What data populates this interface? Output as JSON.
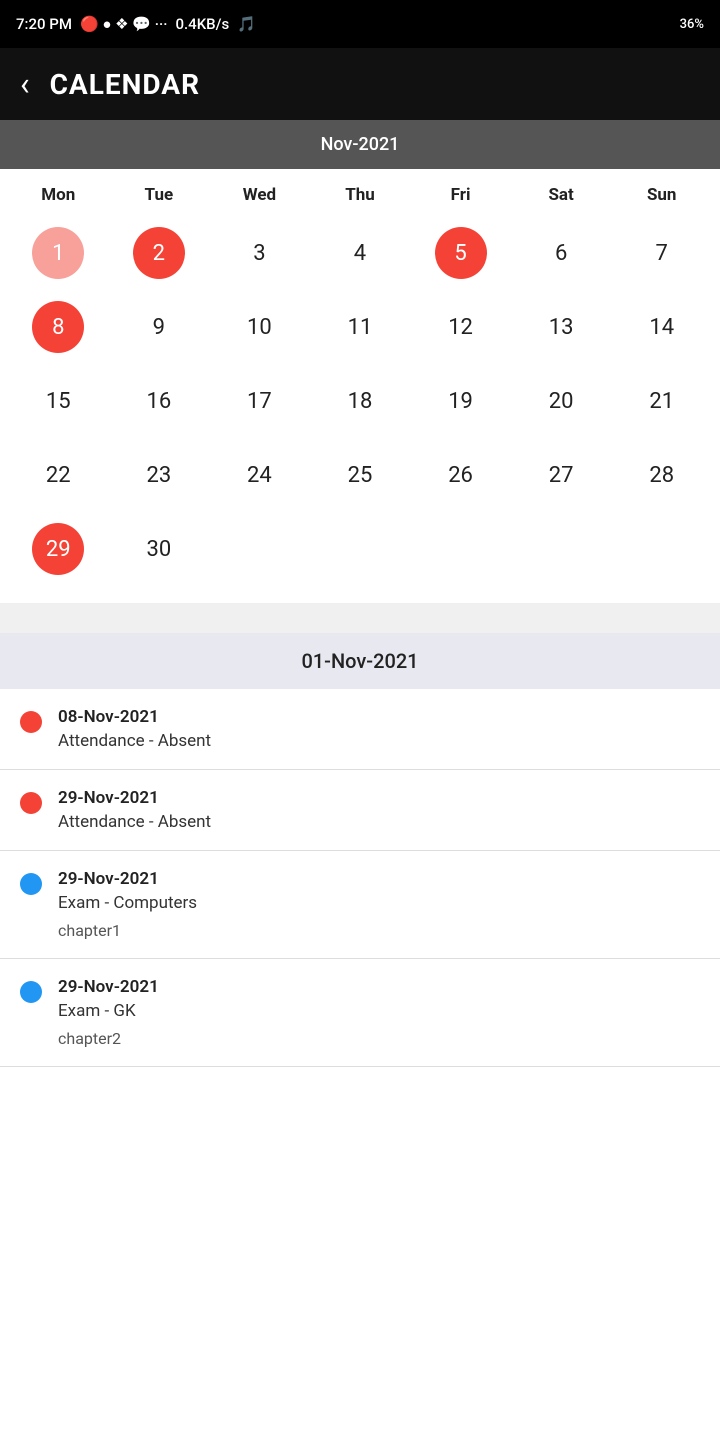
{
  "statusBar": {
    "time": "7:20 PM",
    "network": "0.4KB/s",
    "battery": "36%"
  },
  "header": {
    "back_label": "‹",
    "title": "CALENDAR"
  },
  "calendar": {
    "monthLabel": "Nov-2021",
    "dayHeaders": [
      "Mon",
      "Tue",
      "Wed",
      "Thu",
      "Fri",
      "Sat",
      "Sun"
    ],
    "days": [
      {
        "num": "1",
        "style": "light-highlight"
      },
      {
        "num": "2",
        "style": "highlighted"
      },
      {
        "num": "3",
        "style": "normal"
      },
      {
        "num": "4",
        "style": "normal"
      },
      {
        "num": "5",
        "style": "highlighted"
      },
      {
        "num": "6",
        "style": "normal"
      },
      {
        "num": "7",
        "style": "normal"
      },
      {
        "num": "8",
        "style": "highlighted"
      },
      {
        "num": "9",
        "style": "normal"
      },
      {
        "num": "10",
        "style": "normal"
      },
      {
        "num": "11",
        "style": "normal"
      },
      {
        "num": "12",
        "style": "normal"
      },
      {
        "num": "13",
        "style": "normal"
      },
      {
        "num": "14",
        "style": "normal"
      },
      {
        "num": "15",
        "style": "normal"
      },
      {
        "num": "16",
        "style": "normal"
      },
      {
        "num": "17",
        "style": "normal"
      },
      {
        "num": "18",
        "style": "normal"
      },
      {
        "num": "19",
        "style": "normal"
      },
      {
        "num": "20",
        "style": "normal"
      },
      {
        "num": "21",
        "style": "normal"
      },
      {
        "num": "22",
        "style": "normal"
      },
      {
        "num": "23",
        "style": "normal"
      },
      {
        "num": "24",
        "style": "normal"
      },
      {
        "num": "25",
        "style": "normal"
      },
      {
        "num": "26",
        "style": "normal"
      },
      {
        "num": "27",
        "style": "normal"
      },
      {
        "num": "28",
        "style": "normal"
      },
      {
        "num": "29",
        "style": "highlighted"
      },
      {
        "num": "30",
        "style": "normal"
      }
    ]
  },
  "selectedDate": "01-Nov-2021",
  "events": [
    {
      "dotColor": "red",
      "date": "08-Nov-2021",
      "title": "Attendance - Absent",
      "detail": ""
    },
    {
      "dotColor": "red",
      "date": "29-Nov-2021",
      "title": "Attendance - Absent",
      "detail": ""
    },
    {
      "dotColor": "blue",
      "date": "29-Nov-2021",
      "title": "Exam - Computers",
      "detail": "chapter1"
    },
    {
      "dotColor": "blue",
      "date": "29-Nov-2021",
      "title": "Exam - GK",
      "detail": "chapter2"
    }
  ]
}
